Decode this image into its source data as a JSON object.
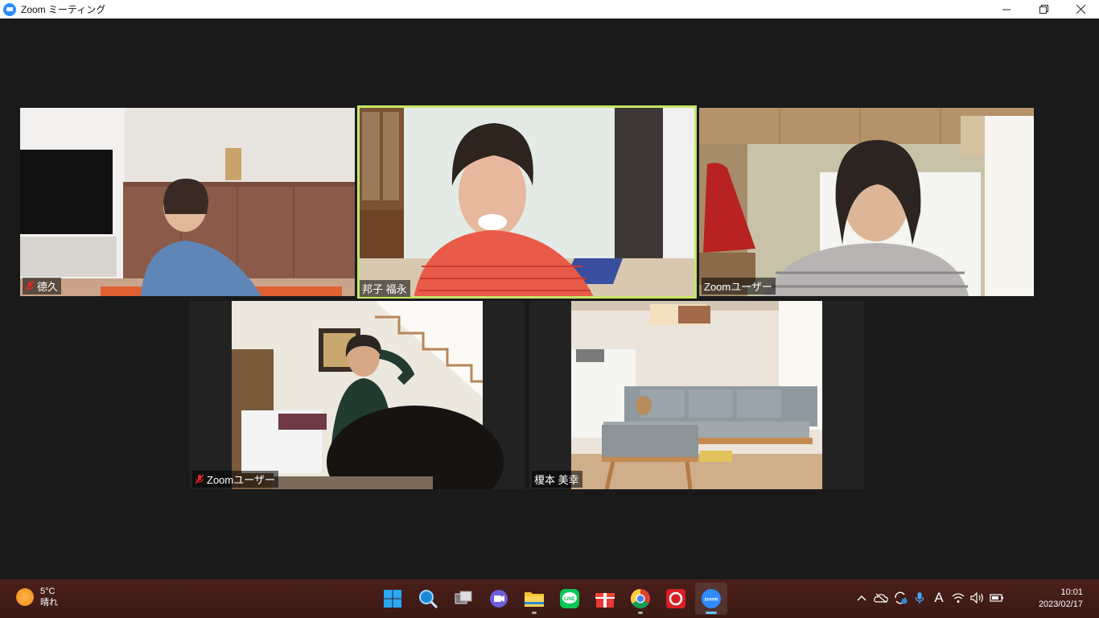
{
  "window": {
    "title": "Zoom ミーティング",
    "controls": [
      "minimize",
      "restore",
      "close"
    ]
  },
  "meeting": {
    "participants": [
      {
        "name": "德久",
        "muted": true,
        "speaking": false
      },
      {
        "name": "邦子 福永",
        "muted": false,
        "speaking": true
      },
      {
        "name": "Zoomユーザー",
        "muted": false,
        "speaking": false
      },
      {
        "name": "Zoomユーザー",
        "muted": true,
        "speaking": false
      },
      {
        "name": "榎本 美幸",
        "muted": false,
        "speaking": false
      }
    ],
    "speaking_color": "#c6e667"
  },
  "taskbar": {
    "weather": {
      "temp": "5°C",
      "condition": "晴れ"
    },
    "apps": [
      {
        "name": "start",
        "icon": "windows-icon"
      },
      {
        "name": "search",
        "icon": "search-icon"
      },
      {
        "name": "task-view",
        "icon": "task-view-icon"
      },
      {
        "name": "teams-chat",
        "icon": "video-chat-icon"
      },
      {
        "name": "file-explorer",
        "icon": "folder-icon"
      },
      {
        "name": "line",
        "icon": "line-icon"
      },
      {
        "name": "gift",
        "icon": "gift-icon"
      },
      {
        "name": "chrome",
        "icon": "chrome-icon"
      },
      {
        "name": "security",
        "icon": "shield-icon"
      },
      {
        "name": "zoom",
        "icon": "zoom-icon",
        "active": true
      }
    ],
    "tray": {
      "ime": "A"
    },
    "clock": {
      "time": "10:01",
      "date": "2023/02/17"
    }
  }
}
